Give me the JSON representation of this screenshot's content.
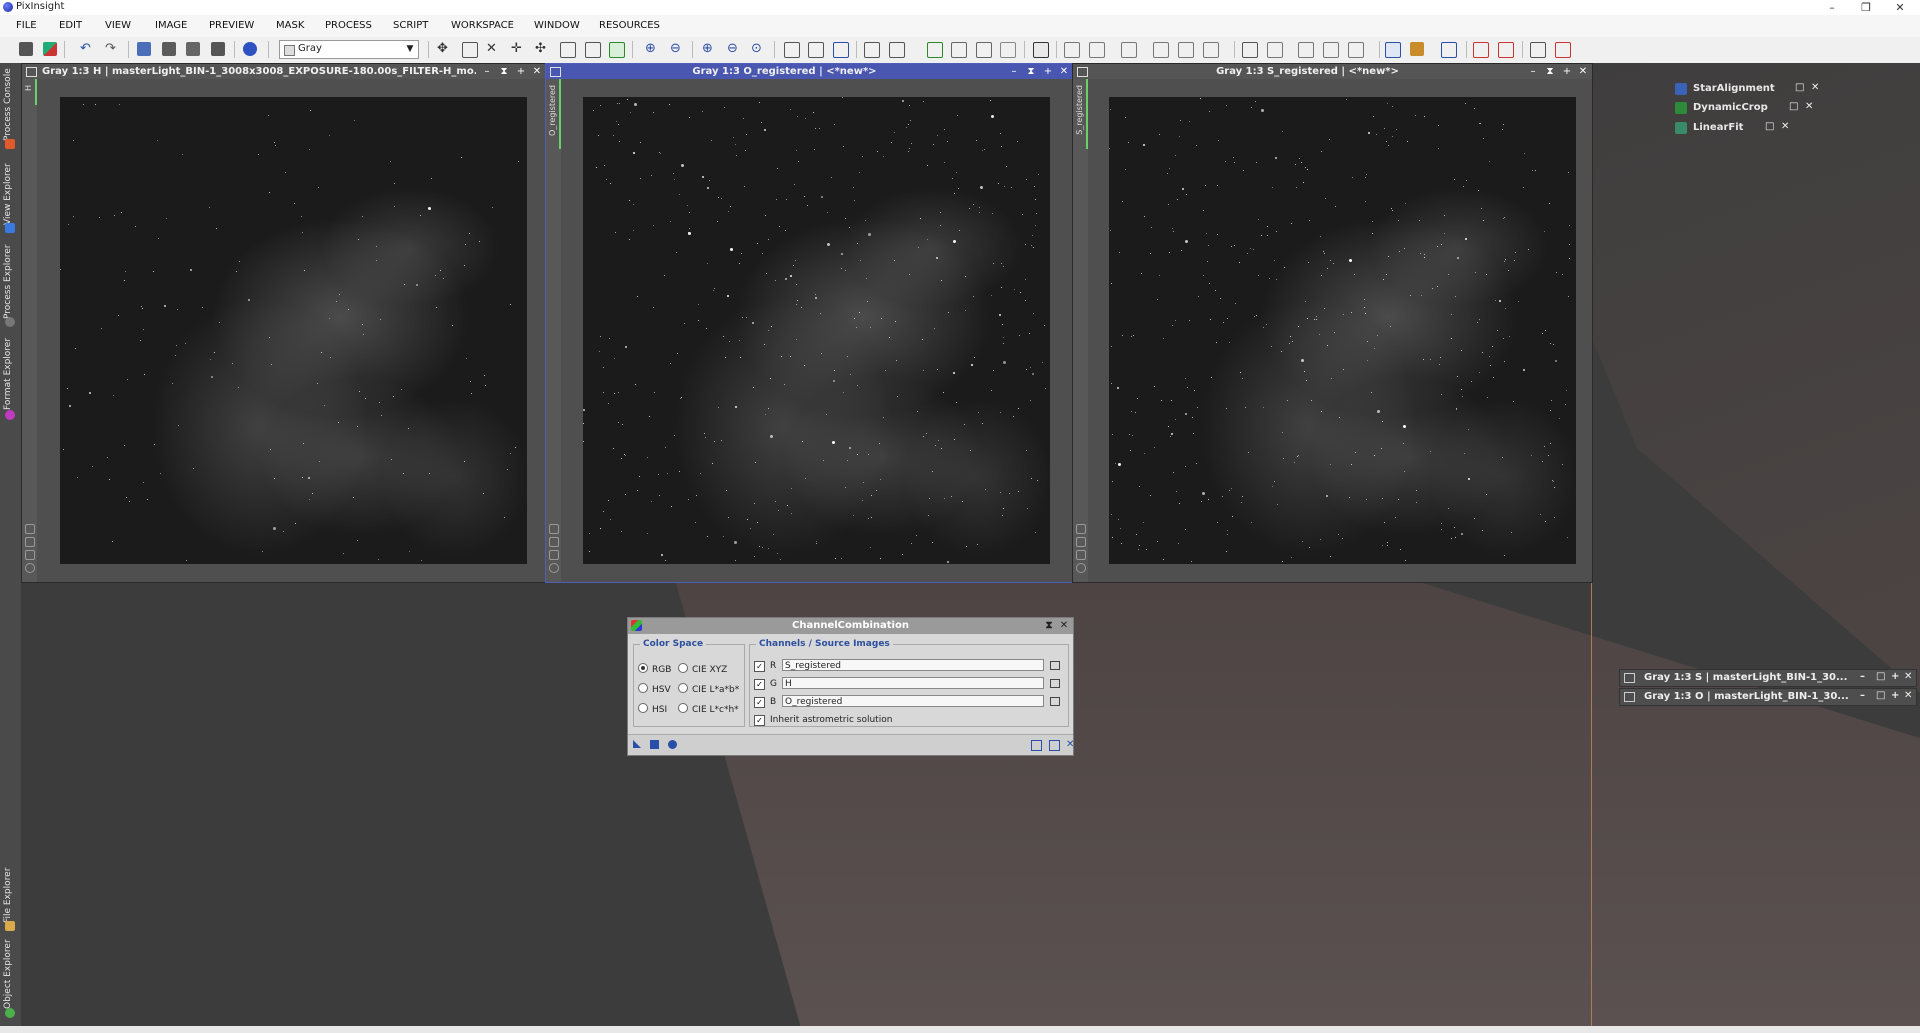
{
  "app": {
    "title": "PixInsight"
  },
  "window_controls": {
    "minimize": "–",
    "restore": "❐",
    "close": "✕"
  },
  "menu": [
    "FILE",
    "EDIT",
    "VIEW",
    "IMAGE",
    "PREVIEW",
    "MASK",
    "PROCESS",
    "SCRIPT",
    "WORKSPACE",
    "WINDOW",
    "RESOURCES"
  ],
  "toolbar": {
    "colorspace_select": "Gray"
  },
  "left_tabs": [
    "Process Console",
    "View Explorer",
    "Process Explorer",
    "Format Explorer",
    "File Explorer",
    "Object Explorer"
  ],
  "image_windows": [
    {
      "title": "Gray 1:3 H | masterLight_BIN-1_3008x3008_EXPOSURE-180.00s_FILTER-H_mo...",
      "side_label": "H",
      "active": false
    },
    {
      "title": "Gray 1:3 O_registered | <*new*>",
      "side_label": "O_registered",
      "active": true
    },
    {
      "title": "Gray 1:3 S_registered | <*new*>",
      "side_label": "S_registered",
      "active": false
    }
  ],
  "win_buttons": {
    "min": "–",
    "shade": "⧗",
    "max": "+",
    "close": "✕"
  },
  "process_icons": [
    {
      "label": "StarAlignment",
      "color": "#3a63b8"
    },
    {
      "label": "DynamicCrop",
      "color": "#2d8a3a"
    },
    {
      "label": "LinearFit",
      "color": "#3a8a6a"
    }
  ],
  "iconized_windows": [
    "Gray 1:3 S | masterLight_BIN-1_30...",
    "Gray 1:3 O | masterLight_BIN-1_30..."
  ],
  "channel_combination": {
    "title": "ChannelCombination",
    "color_space_label": "Color Space",
    "color_spaces": [
      {
        "label": "RGB",
        "selected": true
      },
      {
        "label": "CIE XYZ",
        "selected": false
      },
      {
        "label": "HSV",
        "selected": false
      },
      {
        "label": "CIE L*a*b*",
        "selected": false
      },
      {
        "label": "HSI",
        "selected": false
      },
      {
        "label": "CIE L*c*h*",
        "selected": false
      }
    ],
    "channels_label": "Channels / Source Images",
    "channels": [
      {
        "channel": "R",
        "enabled": true,
        "source": "S_registered"
      },
      {
        "channel": "G",
        "enabled": true,
        "source": "H"
      },
      {
        "channel": "B",
        "enabled": true,
        "source": "O_registered"
      }
    ],
    "inherit_astrometric": {
      "label": "Inherit astrometric solution",
      "checked": true
    },
    "check_mark": "✓"
  }
}
